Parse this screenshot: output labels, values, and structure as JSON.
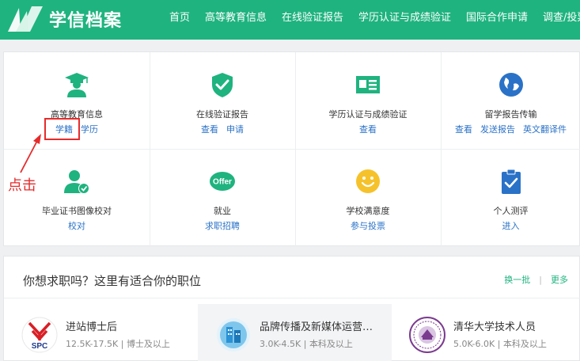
{
  "header": {
    "brand": "学信档案",
    "nav": [
      "首页",
      "高等教育信息",
      "在线验证报告",
      "学历认证与成绩验证",
      "国际合作申请",
      "调查/投票"
    ]
  },
  "services": [
    {
      "title": "高等教育信息",
      "links": [
        "学籍",
        "学历"
      ],
      "icon": "graduate-icon"
    },
    {
      "title": "在线验证报告",
      "links": [
        "查看",
        "申请"
      ],
      "icon": "shield-check-icon"
    },
    {
      "title": "学历认证与成绩验证",
      "links": [
        "查看"
      ],
      "icon": "id-card-icon"
    },
    {
      "title": "留学报告传输",
      "links": [
        "查看",
        "发送报告",
        "英文翻译件"
      ],
      "icon": "globe-icon"
    },
    {
      "title": "毕业证书图像校对",
      "links": [
        "校对"
      ],
      "icon": "user-check-icon"
    },
    {
      "title": "就业",
      "links": [
        "求职招聘"
      ],
      "icon": "offer-icon"
    },
    {
      "title": "学校满意度",
      "links": [
        "参与投票"
      ],
      "icon": "smile-icon"
    },
    {
      "title": "个人测评",
      "links": [
        "进入"
      ],
      "icon": "clipboard-check-icon"
    }
  ],
  "annotation": {
    "text": "点击"
  },
  "jobs": {
    "title": "你想求职吗？这里有适合你的职位",
    "refresh": "换一批",
    "separator": "|",
    "more": "更多",
    "items": [
      {
        "name": "进站博士后",
        "salary": "12.5K-17.5K",
        "degree": "博士及以上",
        "logo": "spc-logo",
        "logo_text": "SPC"
      },
      {
        "name": "品牌传播及新媒体运营…",
        "salary": "3.0K-4.5K",
        "degree": "本科及以上",
        "logo": "building-logo"
      },
      {
        "name": "清华大学技术人员",
        "salary": "5.0K-6.0K",
        "degree": "本科及以上",
        "logo": "tsinghua-seal-logo"
      }
    ]
  },
  "colors": {
    "brand_green": "#1fb37f",
    "link_blue": "#2a72c7",
    "highlight_red": "#e62b2b"
  }
}
